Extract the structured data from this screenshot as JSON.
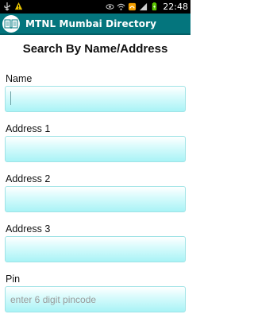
{
  "status_bar": {
    "time": "22:48",
    "icons": [
      "usb-icon",
      "warning-icon",
      "eye-icon",
      "wifi-icon",
      "notification-icon",
      "signal-icon",
      "battery-icon"
    ]
  },
  "action_bar": {
    "title": "MTNL Mumbai Directory",
    "icon": "phone-book-icon"
  },
  "form": {
    "title": "Search By Name/Address",
    "fields": [
      {
        "label": "Name",
        "value": "",
        "placeholder": ""
      },
      {
        "label": "Address 1",
        "value": "",
        "placeholder": ""
      },
      {
        "label": "Address 2",
        "value": "",
        "placeholder": ""
      },
      {
        "label": "Address 3",
        "value": "",
        "placeholder": ""
      },
      {
        "label": "Pin",
        "value": "",
        "placeholder": "enter 6 digit pincode"
      }
    ]
  },
  "colors": {
    "action_bar": "#04757d",
    "input_gradient_end": "#a9f3f6"
  }
}
